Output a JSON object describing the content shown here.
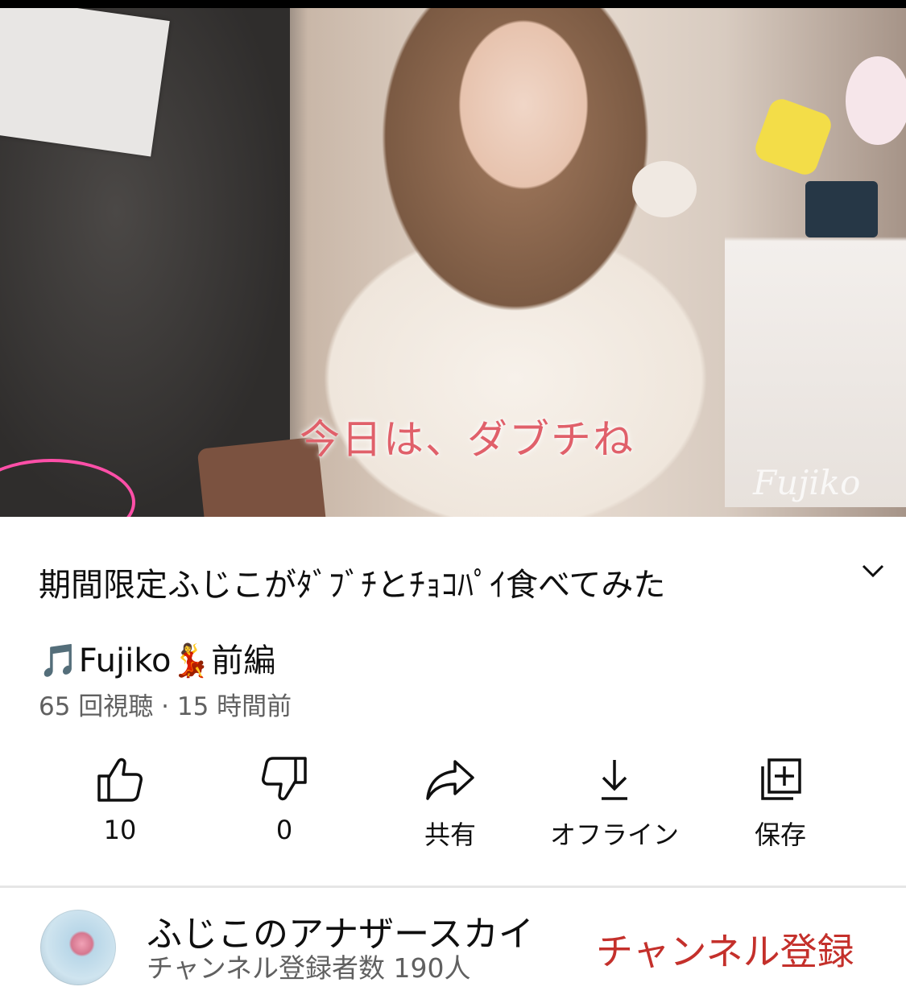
{
  "video": {
    "subtitle": "今日は、ダブチね",
    "watermark": "Fujiko",
    "progress_fraction": 0.04
  },
  "title_line1": "期間限定ふじこがﾀﾞﾌﾞﾁとﾁｮｺﾊﾟｲ食べてみた",
  "title_line2": "🎵Fujiko💃前編",
  "meta": "65 回視聴 · 15 時間前",
  "actions": {
    "like": {
      "label": "10",
      "icon": "thumbs-up-icon"
    },
    "dislike": {
      "label": "0",
      "icon": "thumbs-down-icon"
    },
    "share": {
      "label": "共有",
      "icon": "share-icon"
    },
    "offline": {
      "label": "オフライン",
      "icon": "download-icon"
    },
    "save": {
      "label": "保存",
      "icon": "add-to-playlist-icon"
    }
  },
  "channel": {
    "name": "ふじこのアナザースカイ",
    "subscribers": "チャンネル登録者数 190人",
    "subscribe_label": "チャンネル登録"
  },
  "colors": {
    "accent": "#c4302b",
    "progress": "#e62117",
    "secondary_text": "#606060"
  }
}
